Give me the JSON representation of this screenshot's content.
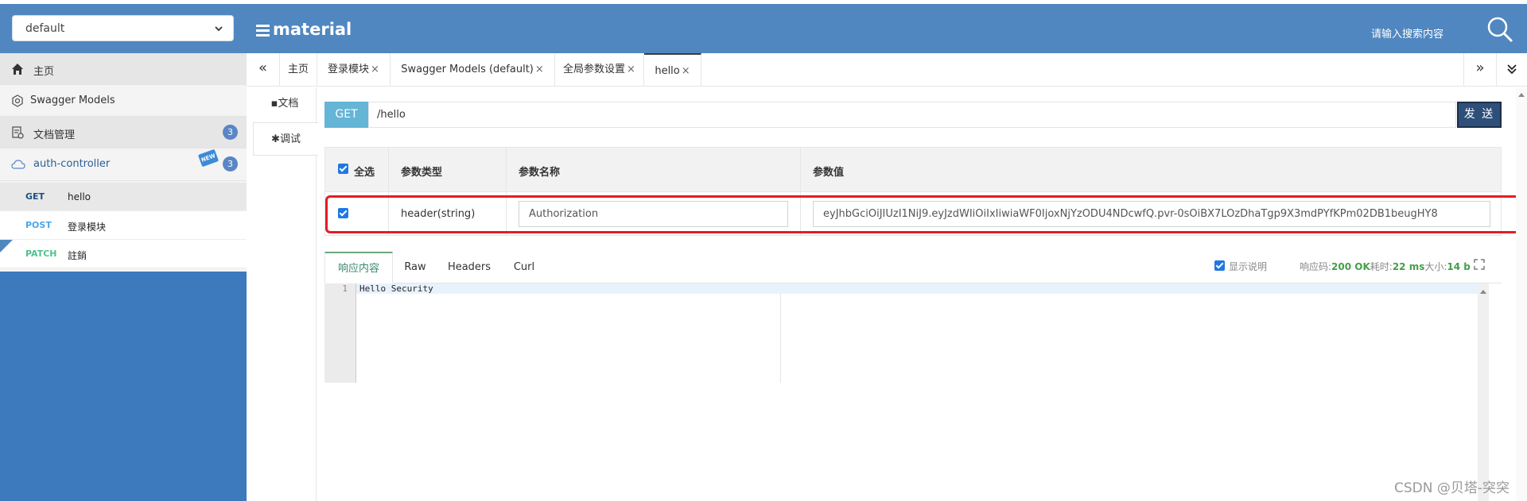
{
  "header": {
    "group_select": "default",
    "brand": "material",
    "search_placeholder": "请输入搜索内容"
  },
  "sidebar": {
    "items": [
      {
        "label": "主页",
        "icon": "home-icon"
      },
      {
        "label": "Swagger Models",
        "icon": "swagger-icon"
      },
      {
        "label": "文档管理",
        "icon": "doc-manage-icon",
        "badge": "3"
      },
      {
        "label": "auth-controller",
        "icon": "cloud-icon",
        "badge": "3",
        "new": "NEW"
      }
    ],
    "apis": [
      {
        "method": "GET",
        "name": "hello",
        "color": "#1f4f86"
      },
      {
        "method": "POST",
        "name": "登录模块",
        "color": "#49a7e8"
      },
      {
        "method": "PATCH",
        "name": "註銷",
        "color": "#50c08f"
      }
    ]
  },
  "tabs": [
    "主页",
    "登录模块",
    "Swagger Models (default)",
    "全局参数设置",
    "hello"
  ],
  "tab_close": "×",
  "left_tabs": {
    "doc": "文档",
    "debug": "调试"
  },
  "request": {
    "method": "GET",
    "url": "/hello",
    "send_label": "发 送"
  },
  "params": {
    "headers": [
      "全选",
      "参数类型",
      "参数名称",
      "参数值"
    ],
    "rows": [
      {
        "type": "header(string)",
        "name": "Authorization",
        "value": "eyJhbGciOiJIUzI1NiJ9.eyJzdWIiOiIxIiwiaWF0IjoxNjYzODU4NDcwfQ.pvr-0sOiBX7LOzDhaTgp9X3mdPYfKPm02DB1beugHY8"
      }
    ]
  },
  "response": {
    "tabs": [
      "响应内容",
      "Raw",
      "Headers",
      "Curl"
    ],
    "show_desc": "显示说明",
    "status_label": "响应码:",
    "status_value": "200 OK",
    "time_label": "耗时:",
    "time_value": "22 ms",
    "size_label": "大小:",
    "size_value": "14 b",
    "line_number": "1",
    "body": "Hello Security"
  },
  "watermark": "CSDN @贝塔-突突"
}
